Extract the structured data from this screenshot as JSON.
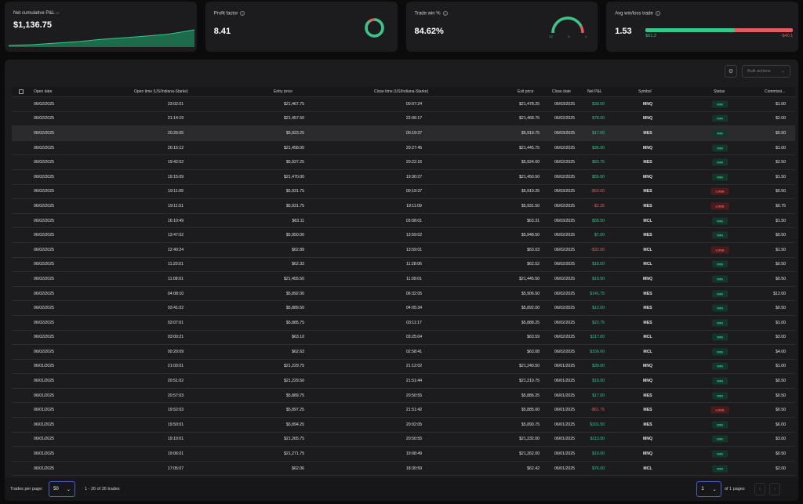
{
  "summary": {
    "net_pnl": {
      "label": "Net cumulative P&L",
      "count": "26",
      "value": "$1,136.75"
    },
    "profit_factor": {
      "label": "Profit factor",
      "value": "8.41"
    },
    "trade_win": {
      "label": "Trade win %",
      "value": "84.62%",
      "wins": "22",
      "breakeven": "0",
      "losses": "4"
    },
    "avg_win_loss": {
      "label": "Avg win/loss trade",
      "value": "1.53",
      "avg_win": "$61.2",
      "avg_loss": "-$40.1"
    }
  },
  "toolbar": {
    "bulk_actions_label": "Bulk actions"
  },
  "table": {
    "columns": [
      "Open date",
      "Open time (US/Indiana-Starke)",
      "Entry price",
      "Close time (US/Indiana-Starke)",
      "Exit price",
      "Close date",
      "Net P&L",
      "Symbol",
      "Status",
      "Commissi..."
    ],
    "rows": [
      {
        "open_date": "06/02/2025",
        "open_time": "23:02:01",
        "entry": "$21,467.75",
        "close_time": "00:07:24",
        "exit": "$21,478.25",
        "close_date": "06/03/2025",
        "pnl": "$39.50",
        "symbol": "MNQ",
        "status": "WIN",
        "commission": "$1.00"
      },
      {
        "open_date": "06/02/2025",
        "open_time": "21:14:19",
        "entry": "$21,457.50",
        "close_time": "22:06:17",
        "exit": "$21,468.75",
        "close_date": "06/02/2025",
        "pnl": "$78.00",
        "symbol": "MNQ",
        "status": "WIN",
        "commission": "$2.00"
      },
      {
        "open_date": "06/02/2025",
        "open_time": "20:26:05",
        "entry": "$5,923.25",
        "close_time": "00:19:37",
        "exit": "$5,919.75",
        "close_date": "06/03/2025",
        "pnl": "$17.00",
        "symbol": "MES",
        "status": "WIN",
        "commission": "$0.50"
      },
      {
        "open_date": "06/02/2025",
        "open_time": "20:15:12",
        "entry": "$21,458.00",
        "close_time": "20:27:45",
        "exit": "$21,445.75",
        "close_date": "06/02/2025",
        "pnl": "$36.00",
        "symbol": "MNQ",
        "status": "WIN",
        "commission": "$1.00"
      },
      {
        "open_date": "06/02/2025",
        "open_time": "19:42:02",
        "entry": "$5,927.25",
        "close_time": "20:22:16",
        "exit": "$5,924.00",
        "close_date": "06/02/2025",
        "pnl": "$83.75",
        "symbol": "MES",
        "status": "WIN",
        "commission": "$2.50"
      },
      {
        "open_date": "06/02/2025",
        "open_time": "19:15:09",
        "entry": "$21,470.00",
        "close_time": "19:30:27",
        "exit": "$21,450.50",
        "close_date": "06/02/2025",
        "pnl": "$55.00",
        "symbol": "MNQ",
        "status": "WIN",
        "commission": "$1.50"
      },
      {
        "open_date": "06/02/2025",
        "open_time": "19:11:09",
        "entry": "$5,931.75",
        "close_time": "00:19:37",
        "exit": "$5,919.25",
        "close_date": "06/03/2025",
        "pnl": "-$63.00",
        "symbol": "MES",
        "status": "LOSS",
        "commission": "$0.50"
      },
      {
        "open_date": "06/02/2025",
        "open_time": "19:11:01",
        "entry": "$5,931.75",
        "close_time": "19:11:09",
        "exit": "$5,931.50",
        "close_date": "06/02/2025",
        "pnl": "-$2.25",
        "symbol": "MES",
        "status": "LOSS",
        "commission": "$0.75"
      },
      {
        "open_date": "06/02/2025",
        "open_time": "16:10:49",
        "entry": "$63.11",
        "close_time": "03:08:01",
        "exit": "$63.31",
        "close_date": "06/03/2025",
        "pnl": "$58.50",
        "symbol": "MCL",
        "status": "WIN",
        "commission": "$1.50"
      },
      {
        "open_date": "06/02/2025",
        "open_time": "13:47:02",
        "entry": "$5,950.00",
        "close_time": "13:59:02",
        "exit": "$5,948.50",
        "close_date": "06/02/2025",
        "pnl": "$7.00",
        "symbol": "MES",
        "status": "WIN",
        "commission": "$0.50"
      },
      {
        "open_date": "06/02/2025",
        "open_time": "12:40:24",
        "entry": "$62.89",
        "close_time": "13:59:01",
        "exit": "$63.03",
        "close_date": "06/02/2025",
        "pnl": "-$32.50",
        "symbol": "MCL",
        "status": "LOSS",
        "commission": "$1.50"
      },
      {
        "open_date": "06/02/2025",
        "open_time": "11:20:01",
        "entry": "$62.33",
        "close_time": "11:28:06",
        "exit": "$62.52",
        "close_date": "06/02/2025",
        "pnl": "$18.50",
        "symbol": "MCL",
        "status": "WIN",
        "commission": "$0.50"
      },
      {
        "open_date": "06/02/2025",
        "open_time": "11:08:01",
        "entry": "$21,455.50",
        "close_time": "11:09:01",
        "exit": "$21,445.50",
        "close_date": "06/02/2025",
        "pnl": "$19.50",
        "symbol": "MNQ",
        "status": "WIN",
        "commission": "$0.50"
      },
      {
        "open_date": "06/02/2025",
        "open_time": "04:08:10",
        "entry": "$5,892.00",
        "close_time": "06:32:05",
        "exit": "$5,906.50",
        "close_date": "06/02/2025",
        "pnl": "$141.75",
        "symbol": "MES",
        "status": "WIN",
        "commission": "$12.00"
      },
      {
        "open_date": "06/02/2025",
        "open_time": "03:41:02",
        "entry": "$5,889.50",
        "close_time": "04:05:34",
        "exit": "$5,892.00",
        "close_date": "06/02/2025",
        "pnl": "$12.00",
        "symbol": "MES",
        "status": "WIN",
        "commission": "$0.50"
      },
      {
        "open_date": "06/02/2025",
        "open_time": "03:07:01",
        "entry": "$5,885.75",
        "close_time": "03:11:17",
        "exit": "$5,888.25",
        "close_date": "06/02/2025",
        "pnl": "$22.75",
        "symbol": "MES",
        "status": "WIN",
        "commission": "$1.00"
      },
      {
        "open_date": "06/02/2025",
        "open_time": "03:00:21",
        "entry": "$63.10",
        "close_time": "03:25:04",
        "exit": "$63.59",
        "close_date": "06/02/2025",
        "pnl": "$117.00",
        "symbol": "MCL",
        "status": "WIN",
        "commission": "$3.00"
      },
      {
        "open_date": "06/02/2025",
        "open_time": "00:20:09",
        "entry": "$62.63",
        "close_time": "02:58:41",
        "exit": "$63.08",
        "close_date": "06/02/2025",
        "pnl": "$156.00",
        "symbol": "MCL",
        "status": "WIN",
        "commission": "$4.00"
      },
      {
        "open_date": "06/01/2025",
        "open_time": "21:03:01",
        "entry": "$21,229.75",
        "close_time": "21:12:02",
        "exit": "$21,240.50",
        "close_date": "06/01/2025",
        "pnl": "$39.00",
        "symbol": "MNQ",
        "status": "WIN",
        "commission": "$1.00"
      },
      {
        "open_date": "06/01/2025",
        "open_time": "20:51:02",
        "entry": "$21,229.50",
        "close_time": "21:51:44",
        "exit": "$21,219.75",
        "close_date": "06/01/2025",
        "pnl": "$19.00",
        "symbol": "MNQ",
        "status": "WIN",
        "commission": "$0.50"
      },
      {
        "open_date": "06/01/2025",
        "open_time": "20:57:03",
        "entry": "$5,889.75",
        "close_time": "20:50:55",
        "exit": "$5,886.25",
        "close_date": "06/01/2025",
        "pnl": "$17.00",
        "symbol": "MES",
        "status": "WIN",
        "commission": "$0.50"
      },
      {
        "open_date": "06/01/2025",
        "open_time": "19:52:03",
        "entry": "$5,897.25",
        "close_time": "21:51:42",
        "exit": "$5,885.00",
        "close_date": "06/01/2025",
        "pnl": "-$61.75",
        "symbol": "MES",
        "status": "LOSS",
        "commission": "$0.50"
      },
      {
        "open_date": "06/01/2025",
        "open_time": "19:50:01",
        "entry": "$5,894.25",
        "close_time": "20:02:05",
        "exit": "$5,890.75",
        "close_date": "06/01/2025",
        "pnl": "$201.50",
        "symbol": "MES",
        "status": "WIN",
        "commission": "$6.00"
      },
      {
        "open_date": "06/01/2025",
        "open_time": "19:10:01",
        "entry": "$21,265.75",
        "close_time": "20:50:55",
        "exit": "$21,232.00",
        "close_date": "06/01/2025",
        "pnl": "$113.50",
        "symbol": "MNQ",
        "status": "WIN",
        "commission": "$3.00"
      },
      {
        "open_date": "06/01/2025",
        "open_time": "19:06:01",
        "entry": "$21,271.75",
        "close_time": "19:08:49",
        "exit": "$21,262.00",
        "close_date": "06/01/2025",
        "pnl": "$19.00",
        "symbol": "MNQ",
        "status": "WIN",
        "commission": "$0.50"
      },
      {
        "open_date": "06/01/2025",
        "open_time": "17:05:07",
        "entry": "$62.06",
        "close_time": "18:30:59",
        "exit": "$62.42",
        "close_date": "06/01/2025",
        "pnl": "$76.00",
        "symbol": "MCL",
        "status": "WIN",
        "commission": "$2.00"
      }
    ]
  },
  "footer": {
    "per_page_label": "Trades per page:",
    "per_page_value": "50",
    "range_text": "1 - 26 of 26 trades",
    "page_value": "1",
    "pages_text": "of 1 pages"
  },
  "colors": {
    "win": "#34c88b",
    "loss": "#e35d5d",
    "accent": "#4a63c4"
  },
  "icons": {
    "settings": "gear-icon",
    "dropdown": "chevron-down-icon"
  }
}
